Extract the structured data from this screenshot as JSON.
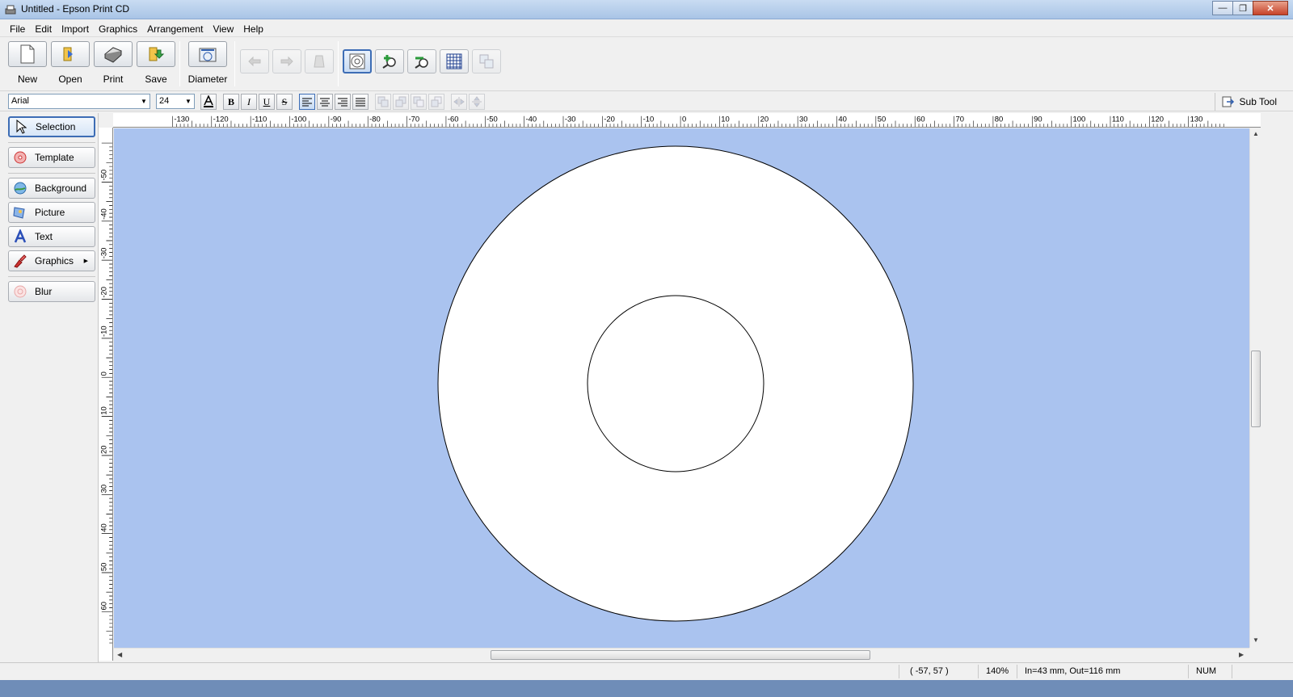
{
  "window": {
    "title": "Untitled - Epson Print CD"
  },
  "menu": [
    "File",
    "Edit",
    "Import",
    "Graphics",
    "Arrangement",
    "View",
    "Help"
  ],
  "toolbar": {
    "new_label": "New",
    "open_label": "Open",
    "print_label": "Print",
    "save_label": "Save",
    "diameter_label": "Diameter"
  },
  "format": {
    "font_name": "Arial",
    "font_size": "24",
    "bold": "B",
    "italic": "I",
    "underline": "U",
    "shadow": "S",
    "subtool_label": "Sub Tool"
  },
  "tools": {
    "selection": "Selection",
    "template": "Template",
    "background": "Background",
    "picture": "Picture",
    "text": "Text",
    "graphics": "Graphics",
    "blur": "Blur"
  },
  "ruler": {
    "h_labels": [
      "-130",
      "-120",
      "-110",
      "-100",
      "-90",
      "-80",
      "-70",
      "-60",
      "-50",
      "-40",
      "-30",
      "-20",
      "-10",
      "0",
      "10",
      "20",
      "30",
      "40",
      "50",
      "60",
      "70",
      "80",
      "90",
      "100",
      "110",
      "120",
      "130"
    ],
    "v_labels": [
      "-50",
      "-40",
      "-30",
      "-20",
      "-10",
      "0",
      "10",
      "20",
      "30",
      "40",
      "50",
      "60"
    ]
  },
  "status": {
    "coords": "( -57,  57 )",
    "zoom": "140%",
    "diameter_info": "In=43 mm, Out=116 mm",
    "num": "NUM"
  },
  "colors": {
    "canvas_bg": "#aac3ef",
    "disc": "#ffffff",
    "accent": "#3d6db5"
  }
}
